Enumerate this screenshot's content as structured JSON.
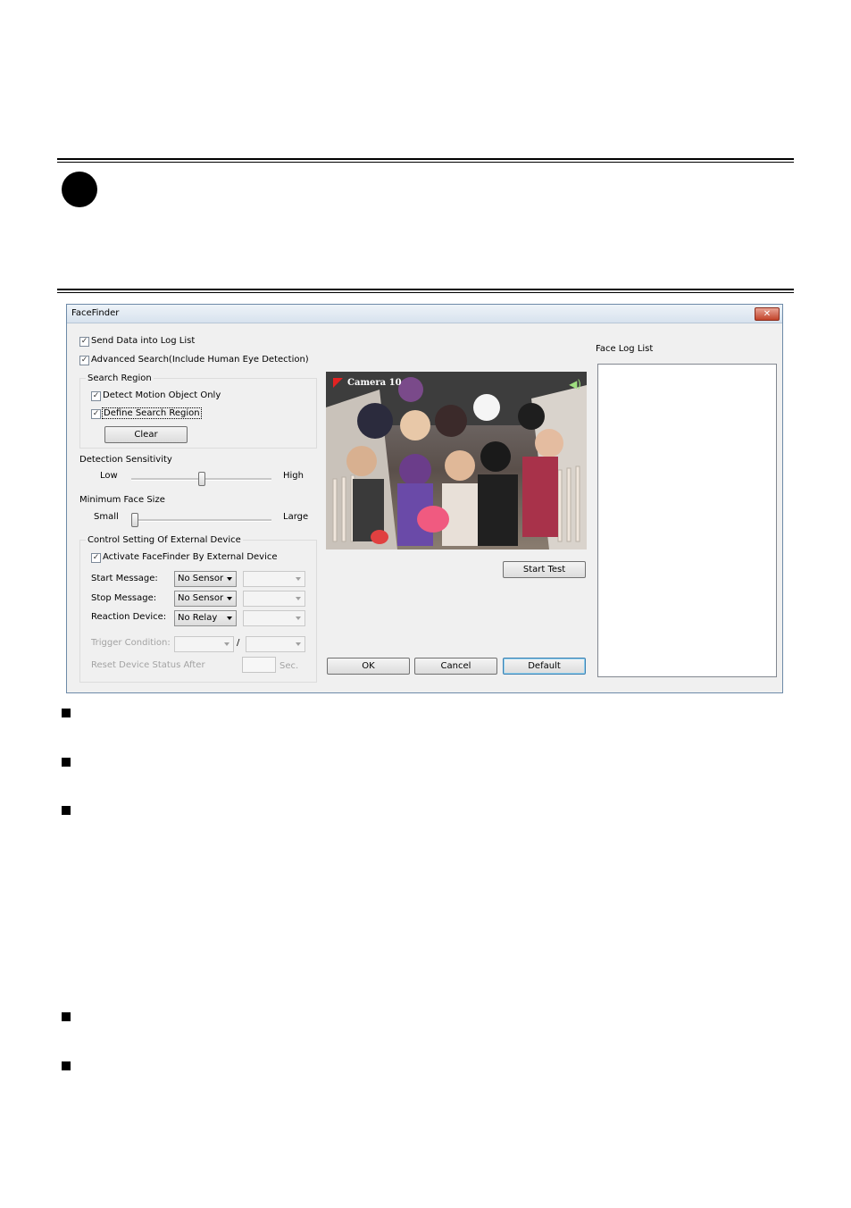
{
  "dialog": {
    "title": "FaceFinder",
    "close_glyph": "✕",
    "send_data_label": "Send Data into Log List",
    "advanced_search_label": "Advanced Search(Include Human Eye Detection)",
    "search_region": {
      "title": "Search Region",
      "detect_motion_label": "Detect Motion Object Only",
      "define_region_label": "Define Search Region",
      "clear_label": "Clear"
    },
    "detection_sensitivity": {
      "title": "Detection Sensitivity",
      "low_label": "Low",
      "high_label": "High",
      "value": 0.5
    },
    "minimum_face_size": {
      "title": "Minimum Face Size",
      "small_label": "Small",
      "large_label": "Large",
      "value": 0.0
    },
    "external_device": {
      "title": "Control Setting Of External Device",
      "activate_label": "Activate FaceFinder By External Device",
      "start_message_label": "Start Message:",
      "start_message_value": "No Sensor",
      "stop_message_label": "Stop Message:",
      "stop_message_value": "No Sensor",
      "reaction_device_label": "Reaction Device:",
      "reaction_device_value": "No Relay",
      "trigger_condition_label": "Trigger Condition:",
      "slash": "/",
      "reset_label": "Reset Device Status After",
      "sec_label": "Sec."
    },
    "camera_label": "Camera 10",
    "start_test_label": "Start Test",
    "face_log_title": "Face Log List",
    "ok_label": "OK",
    "cancel_label": "Cancel",
    "default_label": "Default",
    "checkmark": "✓"
  }
}
